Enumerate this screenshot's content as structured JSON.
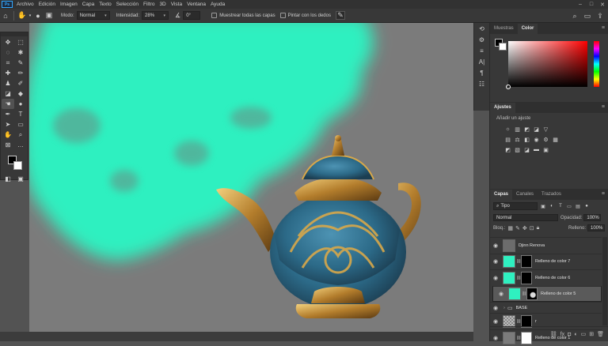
{
  "menubar": {
    "app_badge": "Ps",
    "items": [
      "Archivo",
      "Edición",
      "Imagen",
      "Capa",
      "Texto",
      "Selección",
      "Filtro",
      "3D",
      "Vista",
      "Ventana",
      "Ayuda"
    ]
  },
  "options": {
    "mode_label": "Modo:",
    "mode_value": "Normal",
    "intensity_label": "Intensidad:",
    "intensity_value": "28%",
    "angle_value": "0°",
    "sample_all_label": "Muestrear todas las capas",
    "finger_paint_label": "Pintar con los dedos"
  },
  "panels": {
    "color_tabs": [
      "Muestras",
      "Color"
    ],
    "adjust_tab": "Ajustes",
    "adjust_hint": "Añadir un ajuste",
    "layer_tabs": [
      "Capas",
      "Canales",
      "Trazados"
    ],
    "filter_kind": "Tipo",
    "blend_mode": "Normal",
    "opacity_label": "Opacidad:",
    "opacity_value": "100%",
    "lock_label": "Bloq.:",
    "fill_label": "Relleno:",
    "fill_value": "100%"
  },
  "layers": [
    {
      "name": "Djinn Renova",
      "kind": "smart",
      "selected": false
    },
    {
      "name": "Relleno de color 7",
      "kind": "fill",
      "selected": false
    },
    {
      "name": "Relleno de color 6",
      "kind": "fill",
      "selected": false
    },
    {
      "name": "Relleno de color 5",
      "kind": "fill",
      "selected": true
    },
    {
      "name": "BASE",
      "kind": "group",
      "selected": false
    },
    {
      "name": "r",
      "kind": "masked",
      "selected": false
    },
    {
      "name": "Relleno de color 1",
      "kind": "fill-gray",
      "selected": false
    }
  ],
  "colors": {
    "smoke": "#2ff0c0",
    "canvas_bg": "#7b7b7b",
    "accent": "#31a8ff"
  }
}
